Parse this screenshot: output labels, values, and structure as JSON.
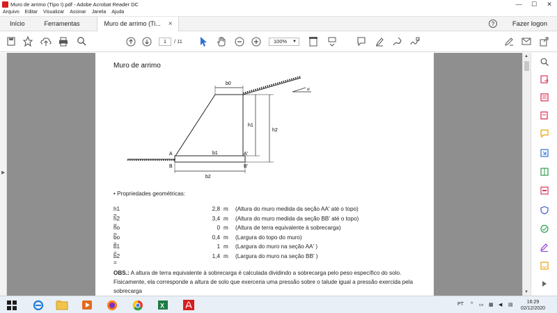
{
  "window": {
    "title": "Muro de arrimo (Tipo I).pdf - Adobe Acrobat Reader DC",
    "minimize": "—",
    "maximize": "☐",
    "close": "✕"
  },
  "menu": [
    "Arquivo",
    "Editar",
    "Visualizar",
    "Assinar",
    "Janela",
    "Ajuda"
  ],
  "tabs": {
    "home": "Início",
    "tools": "Ferramentas",
    "document": "Muro de arrimo (Ti...",
    "close": "×",
    "login": "Fazer logon"
  },
  "toolbar": {
    "current_page": "1",
    "page_total": "/ 11",
    "zoom": "100%"
  },
  "document": {
    "title": "Muro de arrimo",
    "diagram_labels": {
      "b0": "b0",
      "b1": "b1",
      "b2": "b2",
      "h1": "h1",
      "h2": "h2",
      "alpha": "α",
      "A": "A",
      "A_prime": "A'",
      "B": "B",
      "B_prime": "B'"
    },
    "bullet_heading": "• Propriedades geométricas:",
    "properties": [
      {
        "name": "h1 =",
        "value": "2,8",
        "unit": "m",
        "desc": "(Altura do muro medida da seção AA' até o topo)"
      },
      {
        "name": "h2 =",
        "value": "3,4",
        "unit": "m",
        "desc": "(Altura do muro medida da seção BB' até o topo)"
      },
      {
        "name": "ho =",
        "value": "0",
        "unit": "m",
        "desc": "(Altura de terra equivalente à sobrecarga)"
      },
      {
        "name": "bo =",
        "value": "0,4",
        "unit": "m",
        "desc": "(Largura do topo do muro)"
      },
      {
        "name": "b1 =",
        "value": "1",
        "unit": "m",
        "desc": "(Largura do muro na seção AA' )"
      },
      {
        "name": "b2 =",
        "value": "1,4",
        "unit": "m",
        "desc": "(Largura do muro na seção BB' )"
      }
    ],
    "obs_label": "OBS.:",
    "obs_text": " A altura de terra equivalente à sobrecarga é calculada dividindo a sobrecarga pelo peso específico do solo. Fisicamente, ela corresponde a altura de solo que exerceria uma pressão sobre o talude igual a pressão exercida pela sobrecarga"
  },
  "taskbar": {
    "language": "PT",
    "time": "16:29",
    "date": "02/12/2020"
  }
}
